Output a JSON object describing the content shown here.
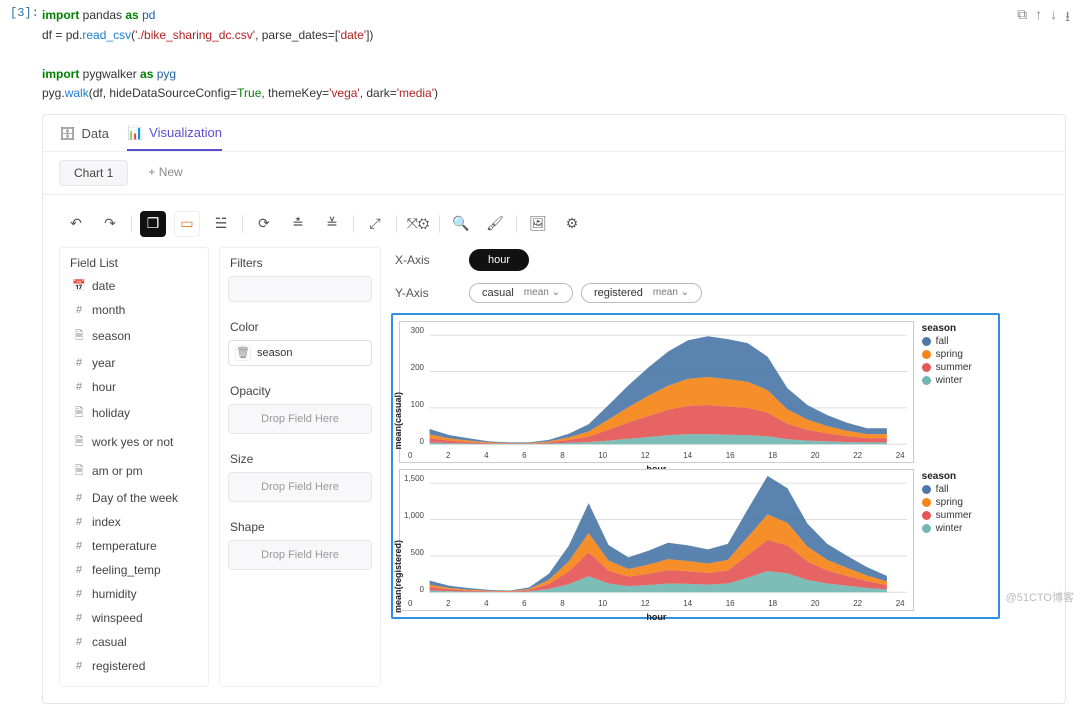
{
  "cell": {
    "prompt": "[3]:",
    "code_tokens": [
      {
        "t": "import ",
        "c": "kw"
      },
      {
        "t": "pandas ",
        "c": ""
      },
      {
        "t": "as ",
        "c": "kw"
      },
      {
        "t": "pd",
        "c": "nm"
      },
      {
        "t": "\n",
        "c": ""
      },
      {
        "t": "df ",
        "c": ""
      },
      {
        "t": "= ",
        "c": ""
      },
      {
        "t": "pd",
        "c": ""
      },
      {
        "t": ".",
        "c": ""
      },
      {
        "t": "read_csv",
        "c": "fn"
      },
      {
        "t": "(",
        "c": ""
      },
      {
        "t": "'./bike_sharing_dc.csv'",
        "c": "st"
      },
      {
        "t": ", parse_dates",
        "c": ""
      },
      {
        "t": "=",
        "c": ""
      },
      {
        "t": "[",
        "c": ""
      },
      {
        "t": "'date'",
        "c": "st"
      },
      {
        "t": "])",
        "c": ""
      },
      {
        "t": "\n\n",
        "c": ""
      },
      {
        "t": "import ",
        "c": "kw"
      },
      {
        "t": "pygwalker ",
        "c": ""
      },
      {
        "t": "as ",
        "c": "kw"
      },
      {
        "t": "pyg",
        "c": "nm"
      },
      {
        "t": "\n",
        "c": ""
      },
      {
        "t": "pyg",
        "c": ""
      },
      {
        "t": ".",
        "c": ""
      },
      {
        "t": "walk",
        "c": "fn"
      },
      {
        "t": "(df, hideDataSourceConfig",
        "c": ""
      },
      {
        "t": "=",
        "c": ""
      },
      {
        "t": "True",
        "c": "bl"
      },
      {
        "t": ", themeKey",
        "c": ""
      },
      {
        "t": "=",
        "c": ""
      },
      {
        "t": "'vega'",
        "c": "st"
      },
      {
        "t": ", dark",
        "c": ""
      },
      {
        "t": "=",
        "c": ""
      },
      {
        "t": "'media'",
        "c": "st"
      },
      {
        "t": ")",
        "c": ""
      }
    ],
    "actions": [
      "⧉",
      "↑",
      "↓",
      "⭳"
    ]
  },
  "tabs": {
    "data": "Data",
    "viz": "Visualization"
  },
  "chartTabs": {
    "chart1": "Chart 1",
    "new": "+ New"
  },
  "fieldList": {
    "title": "Field List",
    "items": [
      {
        "icon": "📅",
        "label": "date",
        "kind": "date"
      },
      {
        "icon": "#",
        "label": "month",
        "kind": "measure"
      },
      {
        "icon": "🗎",
        "label": "season",
        "kind": "dimension"
      },
      {
        "icon": "#",
        "label": "year",
        "kind": "measure"
      },
      {
        "icon": "#",
        "label": "hour",
        "kind": "measure"
      },
      {
        "icon": "🗎",
        "label": "holiday",
        "kind": "dimension"
      },
      {
        "icon": "🗎",
        "label": "work yes or not",
        "kind": "dimension"
      },
      {
        "icon": "🗎",
        "label": "am or pm",
        "kind": "dimension"
      },
      {
        "icon": "#",
        "label": "Day of the week",
        "kind": "measure"
      },
      {
        "icon": "#",
        "label": "index",
        "kind": "measure"
      },
      {
        "icon": "#",
        "label": "temperature",
        "kind": "measure"
      },
      {
        "icon": "#",
        "label": "feeling_temp",
        "kind": "measure"
      },
      {
        "icon": "#",
        "label": "humidity",
        "kind": "measure"
      },
      {
        "icon": "#",
        "label": "winspeed",
        "kind": "measure"
      },
      {
        "icon": "#",
        "label": "casual",
        "kind": "measure"
      },
      {
        "icon": "#",
        "label": "registered",
        "kind": "measure"
      }
    ]
  },
  "shelves": {
    "filters": {
      "title": "Filters",
      "placeholder": ""
    },
    "color": {
      "title": "Color",
      "chip": "season"
    },
    "opacity": {
      "title": "Opacity",
      "placeholder": "Drop Field Here"
    },
    "size": {
      "title": "Size",
      "placeholder": "Drop Field Here"
    },
    "shape": {
      "title": "Shape",
      "placeholder": "Drop Field Here"
    }
  },
  "axes": {
    "x": {
      "label": "X-Axis",
      "pills": [
        {
          "text": "hour",
          "dark": true
        }
      ]
    },
    "y": {
      "label": "Y-Axis",
      "pills": [
        {
          "text": "casual",
          "agg": "mean ⌄"
        },
        {
          "text": "registered",
          "agg": "mean ⌄"
        }
      ]
    }
  },
  "legend": {
    "title": "season",
    "items": [
      {
        "label": "fall",
        "color": "#4c78a8"
      },
      {
        "label": "spring",
        "color": "#f58518"
      },
      {
        "label": "summer",
        "color": "#e45756"
      },
      {
        "label": "winter",
        "color": "#72b7b2"
      }
    ]
  },
  "chart_data": [
    {
      "type": "area",
      "stacked": true,
      "title": "",
      "xlabel": "hour",
      "ylabel": "mean(casual)",
      "x": [
        0,
        1,
        2,
        3,
        4,
        5,
        6,
        7,
        8,
        9,
        10,
        11,
        12,
        13,
        14,
        15,
        16,
        17,
        18,
        19,
        20,
        21,
        22,
        23
      ],
      "xlim": [
        0,
        24
      ],
      "ylim": [
        0,
        320
      ],
      "yticks": [
        0,
        100,
        200,
        300
      ],
      "series": [
        {
          "name": "winter",
          "color": "#72b7b2",
          "values": [
            5,
            3,
            2,
            1,
            1,
            1,
            2,
            4,
            6,
            10,
            15,
            20,
            25,
            28,
            28,
            26,
            25,
            22,
            14,
            10,
            8,
            6,
            5,
            5
          ]
        },
        {
          "name": "summer",
          "color": "#e45756",
          "values": [
            12,
            7,
            4,
            2,
            1,
            1,
            3,
            8,
            15,
            30,
            45,
            58,
            70,
            78,
            80,
            78,
            75,
            65,
            42,
            30,
            22,
            16,
            12,
            12
          ]
        },
        {
          "name": "spring",
          "color": "#f58518",
          "values": [
            10,
            6,
            4,
            2,
            1,
            1,
            3,
            7,
            14,
            28,
            42,
            55,
            66,
            74,
            77,
            75,
            72,
            62,
            40,
            28,
            20,
            15,
            11,
            11
          ]
        },
        {
          "name": "fall",
          "color": "#4c78a8",
          "values": [
            15,
            9,
            6,
            3,
            2,
            2,
            4,
            10,
            20,
            40,
            60,
            78,
            94,
            106,
            112,
            110,
            106,
            92,
            58,
            40,
            30,
            22,
            16,
            16
          ]
        }
      ]
    },
    {
      "type": "area",
      "stacked": true,
      "title": "",
      "xlabel": "hour",
      "ylabel": "mean(registered)",
      "x": [
        0,
        1,
        2,
        3,
        4,
        5,
        6,
        7,
        8,
        9,
        10,
        11,
        12,
        13,
        14,
        15,
        16,
        17,
        18,
        19,
        20,
        21,
        22,
        23
      ],
      "xlim": [
        0,
        24
      ],
      "ylim": [
        0,
        1600
      ],
      "yticks": [
        0,
        500,
        1000,
        1500
      ],
      "series": [
        {
          "name": "winter",
          "color": "#72b7b2",
          "values": [
            25,
            14,
            9,
            5,
            4,
            12,
            45,
            110,
            220,
            120,
            85,
            100,
            120,
            115,
            105,
            120,
            200,
            290,
            260,
            170,
            120,
            90,
            60,
            40
          ]
        },
        {
          "name": "summer",
          "color": "#e45756",
          "values": [
            45,
            25,
            15,
            9,
            6,
            18,
            70,
            175,
            330,
            175,
            130,
            155,
            185,
            175,
            160,
            180,
            310,
            430,
            385,
            255,
            180,
            135,
            95,
            60
          ]
        },
        {
          "name": "spring",
          "color": "#f58518",
          "values": [
            35,
            20,
            12,
            7,
            5,
            14,
            55,
            140,
            265,
            140,
            105,
            125,
            150,
            140,
            130,
            145,
            250,
            350,
            310,
            205,
            145,
            110,
            75,
            50
          ]
        },
        {
          "name": "fall",
          "color": "#4c78a8",
          "values": [
            55,
            30,
            20,
            11,
            8,
            22,
            85,
            215,
            410,
            215,
            160,
            190,
            225,
            215,
            195,
            220,
            380,
            530,
            475,
            315,
            220,
            165,
            115,
            75
          ]
        }
      ]
    }
  ],
  "watermark": "@51CTO博客"
}
